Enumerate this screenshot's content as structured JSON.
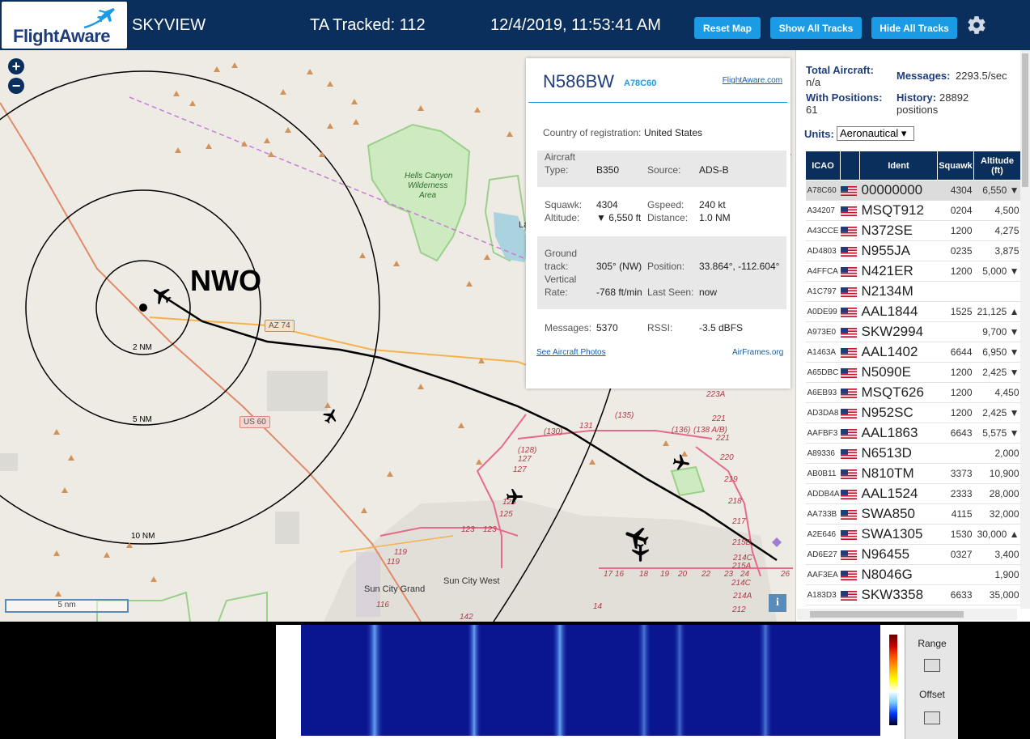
{
  "header": {
    "logo_text": "FlightAware",
    "app_name": "SKYVIEW",
    "tracked": "TA Tracked: 112",
    "datetime": "12/4/2019, 11:53:41 AM",
    "reset_map": "Reset Map",
    "show_all": "Show All Tracks",
    "hide_all": "Hide All Tracks",
    "settings_icon": "gear-icon"
  },
  "map": {
    "zoom_in": "+",
    "zoom_out": "−",
    "site_label": "NWO",
    "range_labels": [
      "2 NM",
      "5 NM",
      "10 NM"
    ],
    "road_labels": [
      "AZ 74",
      "US 60"
    ],
    "place_labels": [
      "Hells Canyon",
      "Wilderness",
      "Area",
      "Sun City Grand",
      "Sun City West",
      "La"
    ],
    "route_numbers": [
      "(135)",
      "131",
      "(130)",
      "(128)",
      "127",
      "127",
      "125",
      "125",
      "123",
      "123",
      "119",
      "119",
      "116",
      "142",
      "(136)",
      "(138 A/B)",
      "221",
      "221",
      "223A",
      "220",
      "219",
      "218",
      "217",
      "215B",
      "215A",
      "214C",
      "214C",
      "214A",
      "212",
      "17",
      "16",
      "18",
      "19",
      "20",
      "22",
      "23",
      "24",
      "26",
      "14"
    ],
    "scale_label": "5 nm",
    "info_icon": "i"
  },
  "popup": {
    "ident": "N586BW",
    "hex": "A78C60",
    "fa_link": "FlightAware.com",
    "country_label": "Country of registration:",
    "country": "United States",
    "aircraft_type_label1": "Aircraft",
    "aircraft_type_label2": "Type:",
    "aircraft_type": "B350",
    "source_label": "Source:",
    "source": "ADS-B",
    "squawk_label": "Squawk:",
    "squawk": "4304",
    "gspeed_label": "Gspeed:",
    "gspeed": "240 kt",
    "altitude_label": "Altitude:",
    "altitude": "▼ 6,550 ft",
    "distance_label": "Distance:",
    "distance": "1.0 NM",
    "ground_label1": "Ground",
    "ground_label2": "track:",
    "track": "305° (NW)",
    "position_label": "Position:",
    "position": "33.864°, -112.604°",
    "vrate_label1": "Vertical",
    "vrate_label2": "Rate:",
    "vrate": "-768 ft/min",
    "lastseen_label": "Last Seen:",
    "lastseen": "now",
    "messages_label": "Messages:",
    "messages": "5370",
    "rssi_label": "RSSI:",
    "rssi": "-3.5 dBFS",
    "photos_link": "See Aircraft Photos",
    "airframes_link": "AirFrames.org"
  },
  "panel": {
    "total_label": "Total Aircraft:",
    "total_value": "n/a",
    "messages_label": "Messages:",
    "messages_value": "2293.5/sec",
    "withpos_label": "With Positions:",
    "withpos_value": "61",
    "history_label": "History:",
    "history_value": "28892",
    "history_unit": "positions",
    "units_label": "Units:",
    "units_value": "Aeronautical ▾",
    "columns": [
      "ICAO",
      "",
      "Ident",
      "Squawk",
      "Altitude (ft)"
    ],
    "rows": [
      {
        "icao": "A78C60",
        "ident": "00000000",
        "squawk": "4304",
        "alt": "6,550 ▼"
      },
      {
        "icao": "A34207",
        "ident": "MSQT912",
        "squawk": "0204",
        "alt": "4,500"
      },
      {
        "icao": "A43CCE",
        "ident": "N372SE",
        "squawk": "1200",
        "alt": "4,275"
      },
      {
        "icao": "AD4803",
        "ident": "N955JA",
        "squawk": "0235",
        "alt": "3,875"
      },
      {
        "icao": "A4FFCA",
        "ident": "N421ER",
        "squawk": "1200",
        "alt": "5,000 ▼"
      },
      {
        "icao": "A1C797",
        "ident": "N2134M",
        "squawk": "",
        "alt": ""
      },
      {
        "icao": "A0DE99",
        "ident": "AAL1844",
        "squawk": "1525",
        "alt": "21,125 ▲"
      },
      {
        "icao": "A973E0",
        "ident": "SKW2994",
        "squawk": "",
        "alt": "9,700 ▼"
      },
      {
        "icao": "A1463A",
        "ident": "AAL1402",
        "squawk": "6644",
        "alt": "6,950 ▼"
      },
      {
        "icao": "A65DBC",
        "ident": "N5090E",
        "squawk": "1200",
        "alt": "2,425 ▼"
      },
      {
        "icao": "A6EB93",
        "ident": "MSQT626",
        "squawk": "1200",
        "alt": "4,450"
      },
      {
        "icao": "AD3DA8",
        "ident": "N952SC",
        "squawk": "1200",
        "alt": "2,425 ▼"
      },
      {
        "icao": "AAFBF3",
        "ident": "AAL1863",
        "squawk": "6643",
        "alt": "5,575 ▼"
      },
      {
        "icao": "A89336",
        "ident": "N6513D",
        "squawk": "",
        "alt": "2,000"
      },
      {
        "icao": "AB0B11",
        "ident": "N810TM",
        "squawk": "3373",
        "alt": "10,900"
      },
      {
        "icao": "ADDB4A",
        "ident": "AAL1524",
        "squawk": "2333",
        "alt": "28,000"
      },
      {
        "icao": "AA733B",
        "ident": "SWA850",
        "squawk": "4115",
        "alt": "32,000"
      },
      {
        "icao": "A2E646",
        "ident": "SWA1305",
        "squawk": "1530",
        "alt": "30,000 ▲"
      },
      {
        "icao": "AD6E27",
        "ident": "N96455",
        "squawk": "0327",
        "alt": "3,400"
      },
      {
        "icao": "AAF3EA",
        "ident": "N8046G",
        "squawk": "",
        "alt": "1,900"
      },
      {
        "icao": "A183D3",
        "ident": "SKW3358",
        "squawk": "6633",
        "alt": "35,000"
      }
    ]
  },
  "spectrum": {
    "range_label": "Range",
    "offset_label": "Offset"
  },
  "colors": {
    "header_bg": "#0b2f5c",
    "button_blue": "#1b9be3",
    "table_header": "#0b2f5c"
  }
}
